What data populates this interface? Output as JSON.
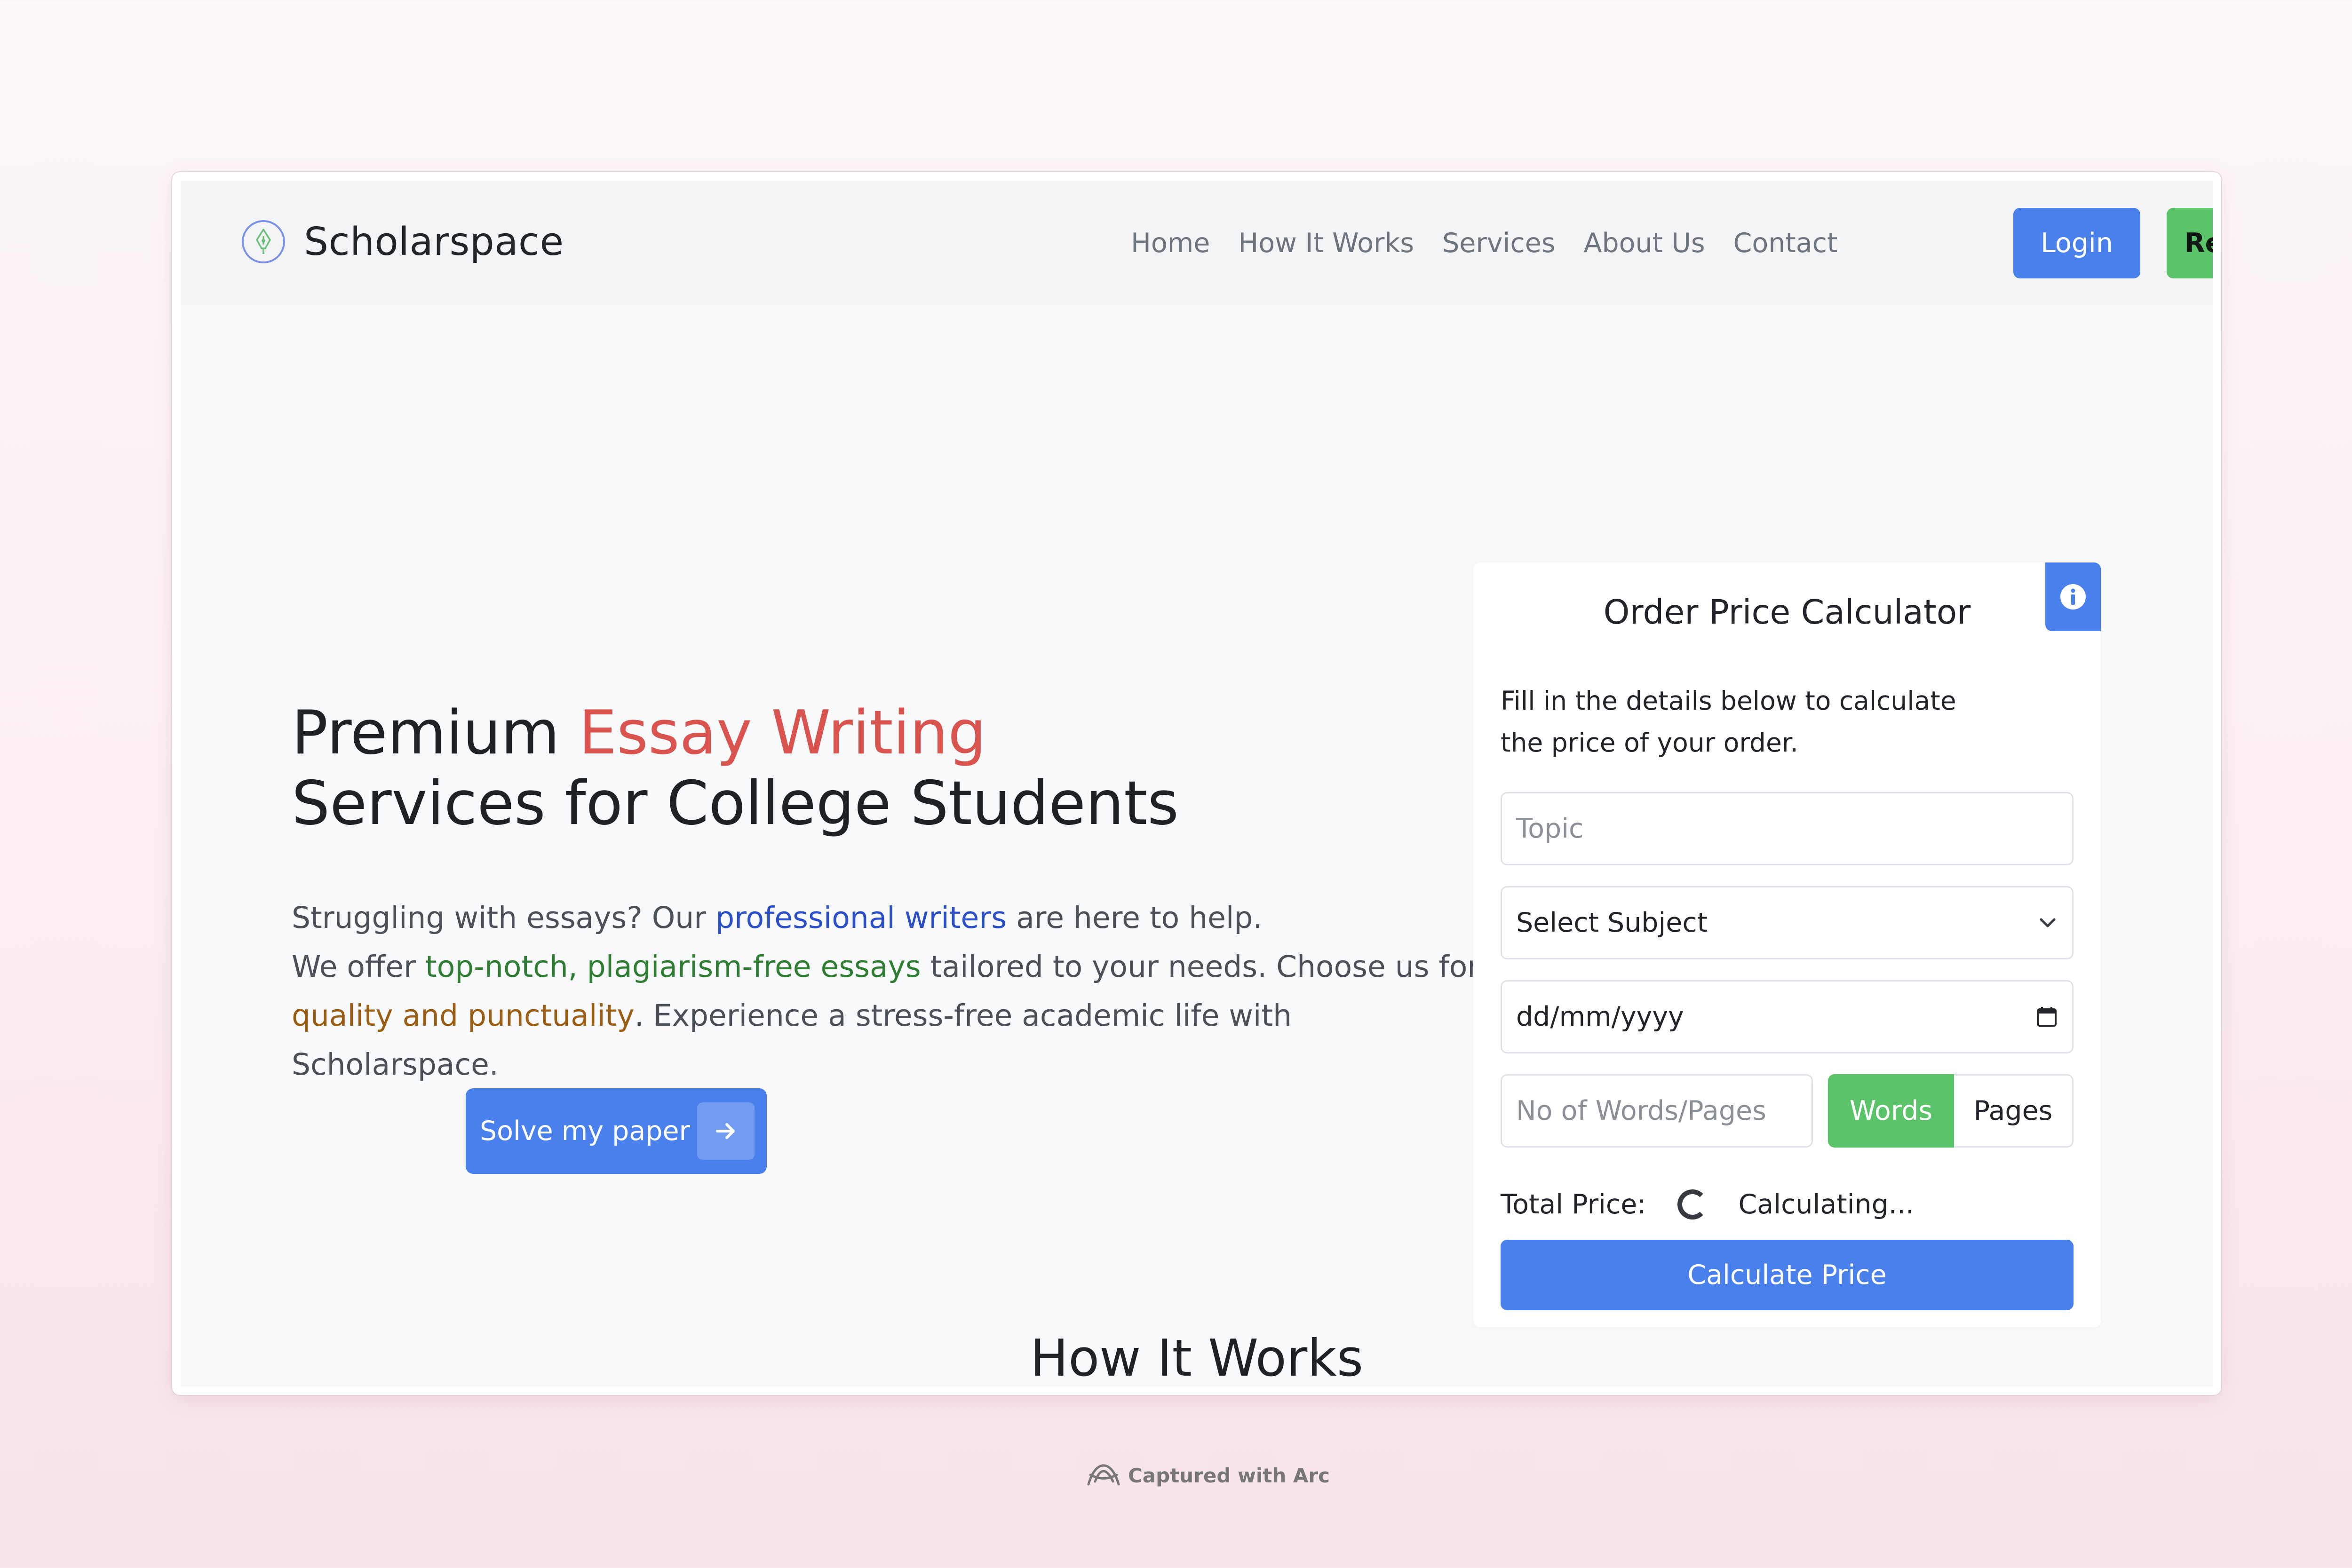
{
  "brand": {
    "name": "Scholarspace",
    "logo_icon": "pen-nib-icon"
  },
  "nav": {
    "links": [
      "Home",
      "How It Works",
      "Services",
      "About Us",
      "Contact"
    ],
    "login_label": "Login",
    "register_label": "Register",
    "colors": {
      "primary": "#4a80ec",
      "success": "#5bc36a"
    }
  },
  "hero": {
    "title_part1": "Premium ",
    "title_accent": "Essay Writing",
    "title_part2": "Services for College Students",
    "desc_1": "Struggling with essays? Our ",
    "desc_hl_writers": "professional writers",
    "desc_2": " are here to help.",
    "desc_3": "We offer ",
    "desc_hl_essays": "top-notch, plagiarism-free essays",
    "desc_4": " tailored to your needs. Choose us for ",
    "desc_hl_quality": "quality and punctuality",
    "desc_5": ". Experience a stress-free academic life with Scholarspace.",
    "cta_label": "Solve my paper",
    "cta_icon": "arrow-right-icon"
  },
  "calculator": {
    "title": "Order Price Calculator",
    "info_icon": "info-icon",
    "description": "Fill in the details below to calculate the price of your order.",
    "topic_placeholder": "Topic",
    "subject_selected": "Select Subject",
    "date_value": "dd/mm/yyyy",
    "count_placeholder": "No of Words/Pages",
    "toggle_words": "Words",
    "toggle_pages": "Pages",
    "total_label": "Total Price:",
    "status": "Calculating...",
    "button_label": "Calculate Price"
  },
  "section": {
    "how_title": "How It Works"
  },
  "capture": {
    "label": "Captured with Arc",
    "icon": "arc-logo-icon"
  }
}
